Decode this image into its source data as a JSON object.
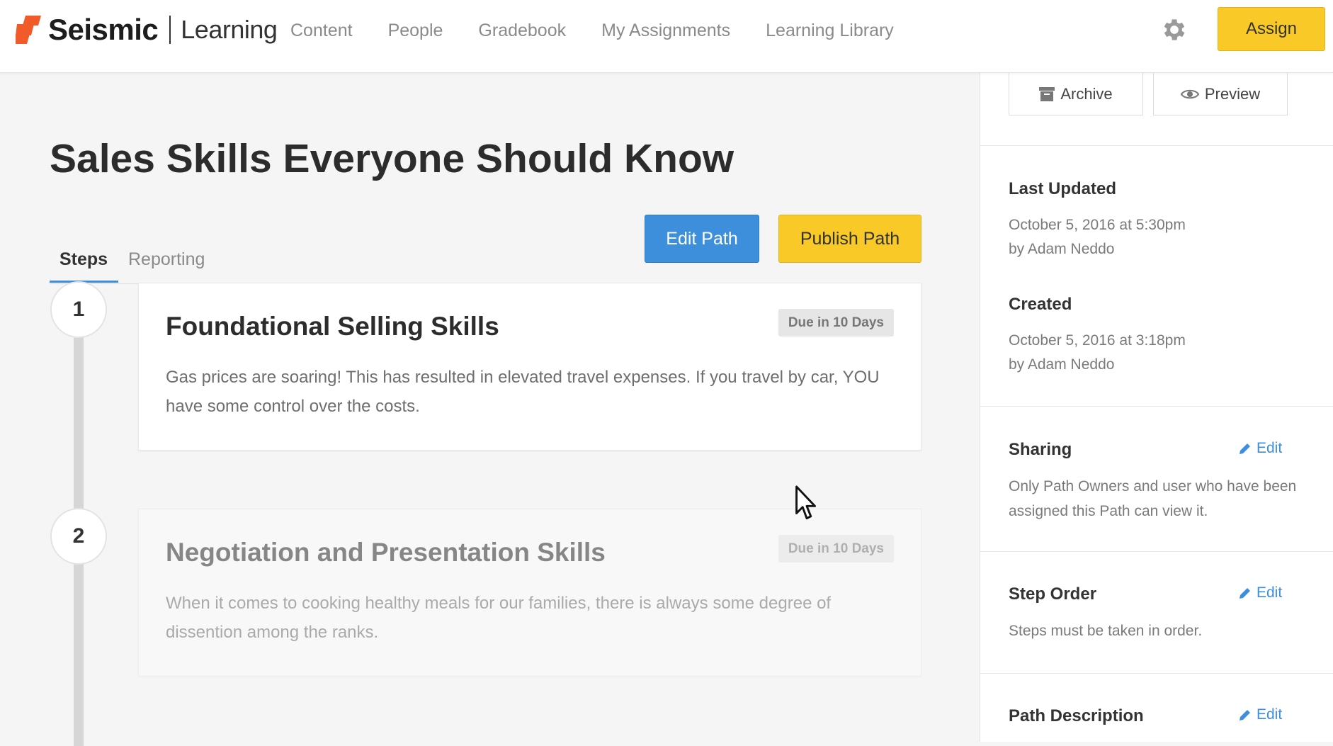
{
  "header": {
    "brand": "Seismic",
    "product": "Learning",
    "nav": [
      "Content",
      "People",
      "Gradebook",
      "My Assignments",
      "Learning Library"
    ],
    "assign_label": "Assign",
    "brand_color": "#f15a29",
    "accent_yellow": "#f8c927"
  },
  "main": {
    "title": "Sales Skills Everyone Should Know",
    "tabs": [
      {
        "label": "Steps",
        "active": true
      },
      {
        "label": "Reporting",
        "active": false
      }
    ],
    "edit_path_label": "Edit Path",
    "publish_path_label": "Publish Path",
    "steps": [
      {
        "number": "1",
        "title": "Foundational Selling Skills",
        "due": "Due in 10 Days",
        "description": "Gas prices are soaring! This has resulted in elevated travel expenses. If you travel by car, YOU have some control over the costs."
      },
      {
        "number": "2",
        "title": "Negotiation and Presentation Skills",
        "due": "Due in 10 Days",
        "description": "When it comes to cooking healthy meals for our families, there is always some degree of dissention among the ranks."
      }
    ]
  },
  "sidebar": {
    "archive_label": "Archive",
    "preview_label": "Preview",
    "last_updated_heading": "Last Updated",
    "last_updated_date": "October 5, 2016 at 5:30pm",
    "last_updated_by": "by Adam Neddo",
    "created_heading": "Created",
    "created_date": "October 5, 2016 at 3:18pm",
    "created_by": "by Adam Neddo",
    "sharing_heading": "Sharing",
    "sharing_text": "Only Path Owners and user who have been assigned this Path can view it.",
    "step_order_heading": "Step Order",
    "step_order_text": "Steps must be taken in order.",
    "path_description_heading": "Path Description",
    "edit_label": "Edit"
  }
}
